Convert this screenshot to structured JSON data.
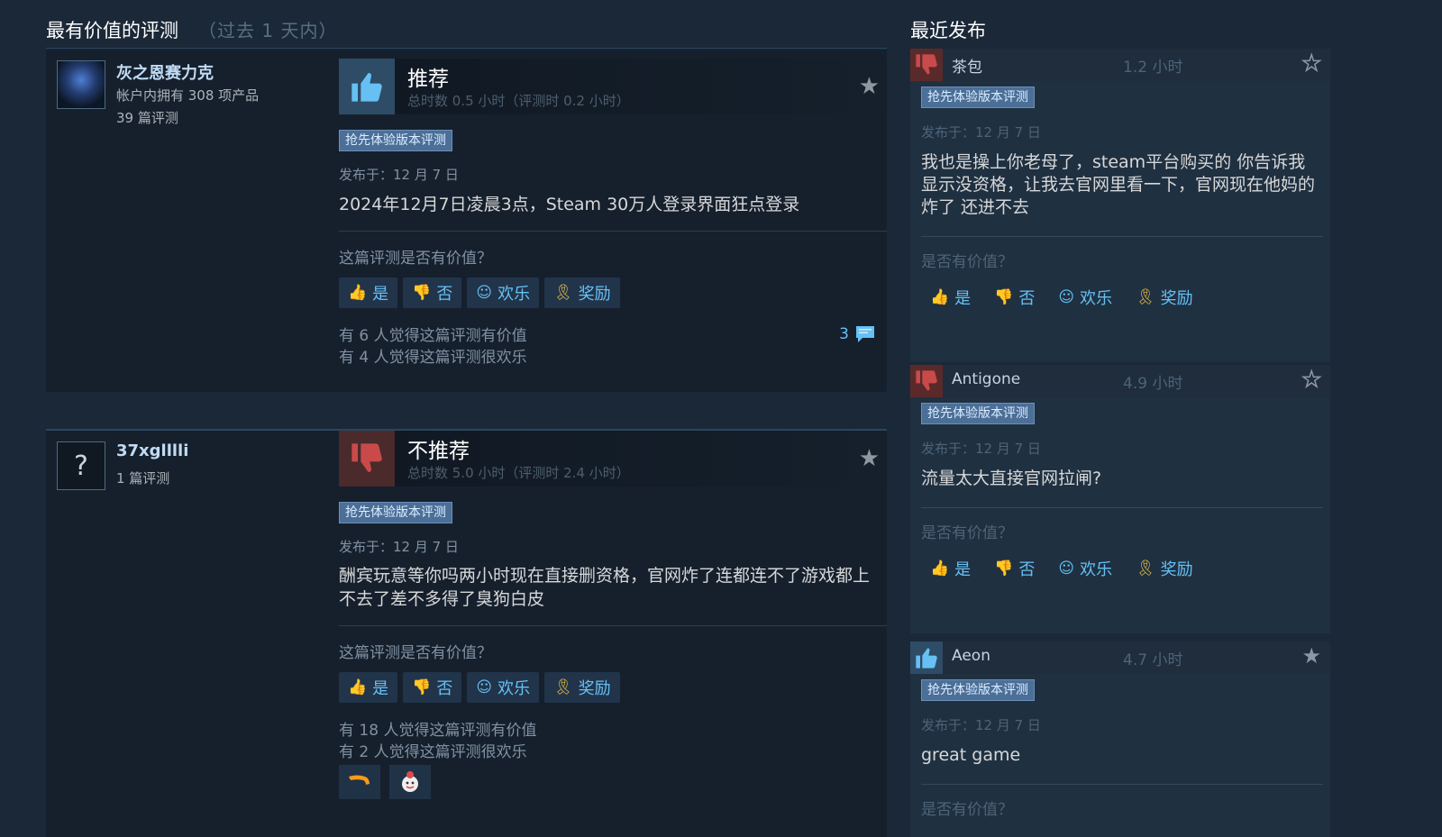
{
  "left": {
    "title": "最有价值的评测",
    "subtitle": "（过去 1 天内）",
    "reviews": [
      {
        "author": "灰之恩赛力克",
        "meta1": "帐户内拥有 308 项产品",
        "meta2": "39 篇评测",
        "verdict": "推荐",
        "hours": "总时数 0.5 小时（评测时 0.2 小时）",
        "tag": "抢先体验版本评测",
        "posted": "发布于：12 月 7 日",
        "content": "2024年12月7日凌晨3点，Steam 30万人登录界面狂点登录",
        "helpful_q": "这篇评测是否有价值？",
        "btn_yes": "是",
        "btn_no": "否",
        "btn_funny": "欢乐",
        "btn_award": "奖励",
        "stat1": "有 6 人觉得这篇评测有价值",
        "stat2": "有 4 人觉得这篇评测很欢乐",
        "comments": "3"
      },
      {
        "author": "37xglllli",
        "meta1": "1 篇评测",
        "verdict": "不推荐",
        "hours": "总时数 5.0 小时（评测时 2.4 小时）",
        "tag": "抢先体验版本评测",
        "posted": "发布于：12 月 7 日",
        "content": "酬宾玩意等你吗两小时现在直接删资格，官网炸了连都连不了游戏都上不去了差不多得了臭狗白皮",
        "helpful_q": "这篇评测是否有价值？",
        "btn_yes": "是",
        "btn_no": "否",
        "btn_funny": "欢乐",
        "btn_award": "奖励",
        "stat1": "有 18 人觉得这篇评测有价值",
        "stat2": "有 2 人觉得这篇评测很欢乐"
      }
    ]
  },
  "right": {
    "title": "最近发布",
    "cards": [
      {
        "name": "茶包",
        "time": "1.2 小时",
        "tag": "抢先体验版本评测",
        "posted": "发布于：12 月 7 日",
        "content": "我也是操上你老母了，steam平台购买的 你告诉我显示没资格，让我去官网里看一下，官网现在他妈的炸了 还进不去",
        "q": "是否有价值？",
        "btn_yes": "是",
        "btn_no": "否",
        "btn_funny": "欢乐",
        "btn_award": "奖励"
      },
      {
        "name": "Antigone",
        "time": "4.9 小时",
        "tag": "抢先体验版本评测",
        "posted": "发布于：12 月 7 日",
        "content": "流量太大直接官网拉闸?",
        "q": "是否有价值？",
        "btn_yes": "是",
        "btn_no": "否",
        "btn_funny": "欢乐",
        "btn_award": "奖励"
      },
      {
        "name": "Aeon",
        "time": "4.7 小时",
        "tag": "抢先体验版本评测",
        "posted": "发布于：12 月 7 日",
        "content": "great game",
        "q": "是否有价值？"
      }
    ]
  },
  "colors": {
    "background": "#1b2838",
    "link_blue": "#66c0f4",
    "tag_blue": "#4b6f97",
    "award_gold": "#f4c542",
    "thumb_down_red": "#c94a4a"
  }
}
